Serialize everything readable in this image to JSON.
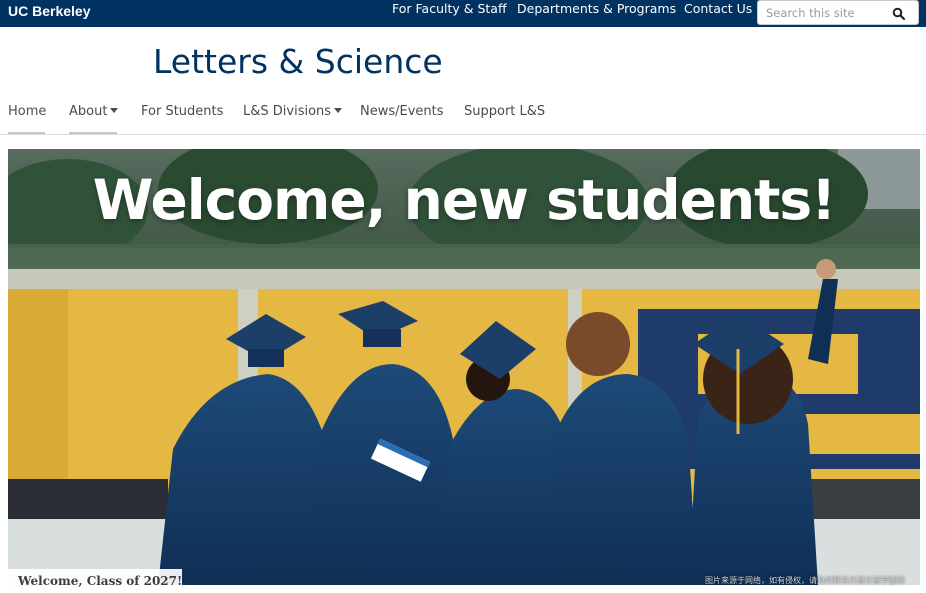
{
  "brand": "UC Berkeley",
  "top_links": [
    "For Faculty & Staff",
    "Departments & Programs",
    "Contact Us"
  ],
  "search": {
    "placeholder": "Search this site",
    "button_icon": "search-icon"
  },
  "site_title": "Letters & Science",
  "nav": [
    {
      "label": "Home",
      "active": true,
      "dropdown": false
    },
    {
      "label": "About",
      "active": false,
      "dropdown": true
    },
    {
      "label": "For Students",
      "active": false,
      "dropdown": false
    },
    {
      "label": "L&S Divisions",
      "active": false,
      "dropdown": true
    },
    {
      "label": "News/Events",
      "active": false,
      "dropdown": false
    },
    {
      "label": "Support L&S",
      "active": false,
      "dropdown": false
    }
  ],
  "hero": {
    "heading": "Welcome, new students!",
    "caption": "Welcome, Class of 2027!",
    "watermark": "图片来源于网络，如有侵权，请及时联系托普仕留学删除"
  },
  "colors": {
    "brand_blue": "#003262",
    "gold": "#e4b842"
  }
}
